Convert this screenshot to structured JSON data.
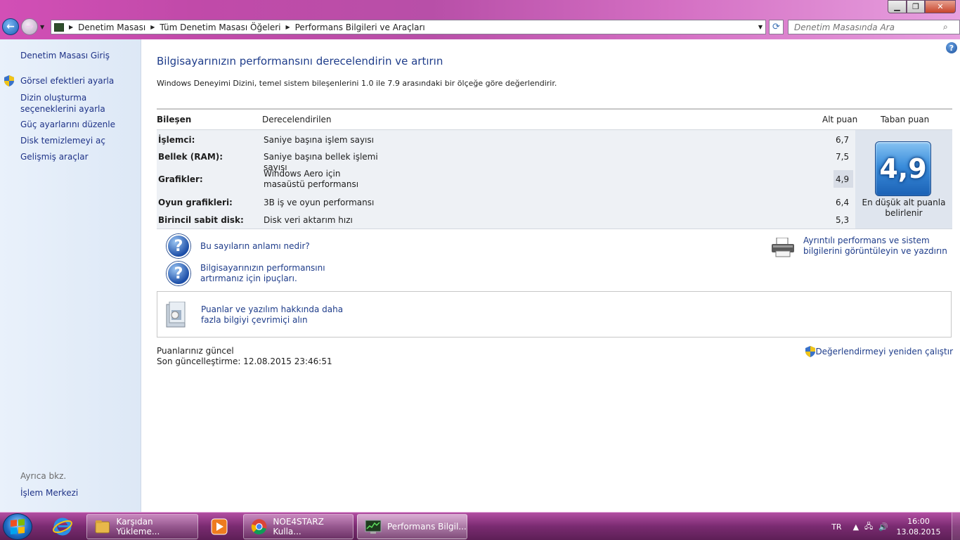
{
  "window": {
    "minimize_icon": "minimize-icon",
    "maximize_icon": "maximize-icon",
    "close_icon": "close-icon"
  },
  "address_bar": {
    "breadcrumbs": [
      "Denetim Masası",
      "Tüm Denetim Masası Öğeleri",
      "Performans Bilgileri ve Araçları"
    ]
  },
  "search": {
    "placeholder": "Denetim Masasında Ara"
  },
  "sidebar": {
    "home": "Denetim Masası Giriş",
    "tasks": [
      {
        "label": "Görsel efektleri ayarla",
        "shield": true
      },
      {
        "label": "Dizin oluşturma seçeneklerini ayarla",
        "shield": false
      },
      {
        "label": "Güç ayarlarını düzenle",
        "shield": false
      },
      {
        "label": "Disk temizlemeyi aç",
        "shield": false
      },
      {
        "label": "Gelişmiş araçlar",
        "shield": false
      }
    ],
    "see_also_title": "Ayrıca bkz.",
    "see_also_items": [
      "İşlem Merkezi"
    ]
  },
  "main": {
    "title": "Bilgisayarınızın performansını derecelendirin ve artırın",
    "description": "Windows Deneyimi Dizini, temel sistem bileşenlerini 1.0 ile 7.9 arasındaki bir ölçeğe göre değerlendirir.",
    "table": {
      "headers": {
        "component": "Bileşen",
        "rated": "Derecelendirilen",
        "subscore": "Alt puan",
        "base_score": "Taban puan"
      },
      "rows": [
        {
          "component": "İşlemci:",
          "rated": "Saniye başına işlem sayısı",
          "subscore": "6,7"
        },
        {
          "component": "Bellek (RAM):",
          "rated": "Saniye başına bellek işlemi sayısı",
          "subscore": "7,5"
        },
        {
          "component": "Grafikler:",
          "rated": "Windows Aero için masaüstü performansı",
          "subscore": "4,9"
        },
        {
          "component": "Oyun grafikleri:",
          "rated": "3B iş ve oyun performansı",
          "subscore": "6,4"
        },
        {
          "component": "Birincil sabit disk:",
          "rated": "Disk veri aktarım hızı",
          "subscore": "5,3"
        }
      ],
      "base_score": "4,9",
      "base_caption": "En düşük alt puanla belirlenir"
    },
    "links": {
      "meaning": "Bu sayıların anlamı nedir?",
      "tips": "Bilgisayarınızın performansını artırmanız için ipuçları.",
      "details": "Ayrıntılı performans ve sistem bilgilerini görüntüleyin ve yazdırın",
      "online": "Puanlar ve yazılım hakkında daha fazla bilgiyi çevrimiçi alın",
      "rerun": "Değerlendirmeyi yeniden çalıştır"
    },
    "status": {
      "line1": "Puanlarınız güncel",
      "line2": "Son güncelleştirme: 12.08.2015 23:46:51"
    }
  },
  "taskbar": {
    "tasks": [
      {
        "label": "Karşıdan Yükleme...",
        "icon": "folder-icon"
      },
      {
        "label": "NOE4STARZ Kulla...",
        "icon": "chrome-icon"
      },
      {
        "label": "Performans Bilgil...",
        "icon": "performance-icon"
      }
    ],
    "language": "TR",
    "time": "16:00",
    "date": "13.08.2015"
  }
}
